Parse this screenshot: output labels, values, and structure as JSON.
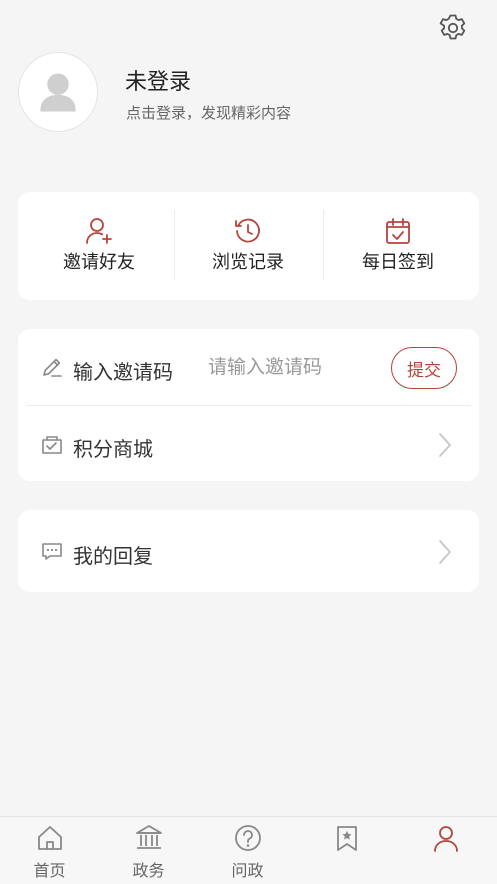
{
  "profile": {
    "title": "未登录",
    "subtitle": "点击登录，发现精彩内容"
  },
  "quick_actions": [
    {
      "label": "邀请好友",
      "icon": "user-add-icon"
    },
    {
      "label": "浏览记录",
      "icon": "history-icon"
    },
    {
      "label": "每日签到",
      "icon": "calendar-check-icon"
    }
  ],
  "invite": {
    "label": "输入邀请码",
    "placeholder": "请输入邀请码",
    "value": "",
    "submit_label": "提交",
    "icon": "pencil-icon"
  },
  "mall": {
    "label": "积分商城",
    "icon": "gift-box-icon"
  },
  "replies": {
    "label": "我的回复",
    "icon": "chat-bubble-icon"
  },
  "tabs": [
    {
      "label": "首页",
      "icon": "home-icon"
    },
    {
      "label": "政务",
      "icon": "government-building-icon"
    },
    {
      "label": "问政",
      "icon": "question-circle-icon"
    },
    {
      "label": "",
      "icon": "star-bookmark-icon"
    },
    {
      "label": "",
      "icon": "profile-icon",
      "active": true
    }
  ],
  "colors": {
    "accent": "#b4453c",
    "background": "#f5f5f5",
    "card": "#ffffff"
  }
}
